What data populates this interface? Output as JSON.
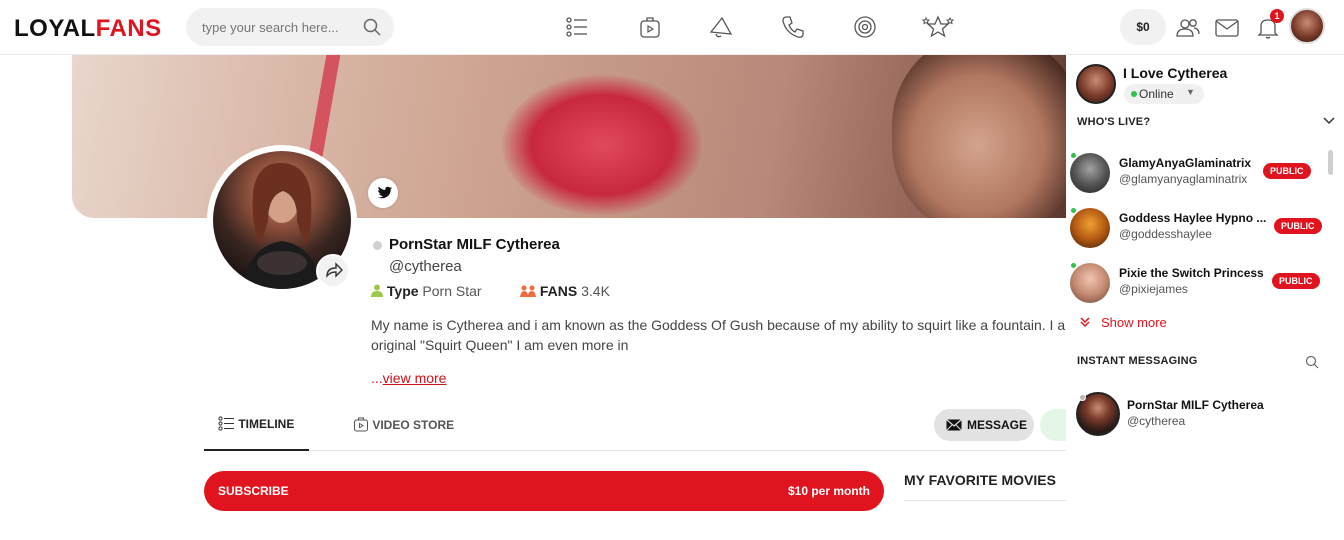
{
  "header": {
    "logo_part1": "LOYAL",
    "logo_part2": "FANS",
    "search_placeholder": "type your search here...",
    "nav_icons": [
      "timeline-list-icon",
      "video-store-icon",
      "megaphone-icon",
      "phone-icon",
      "target-icon",
      "stars-icon"
    ],
    "wallet_balance": "$0",
    "notification_count": "1"
  },
  "profile": {
    "name": "PornStar MILF Cytherea",
    "handle": "@cytherea",
    "type_label": "Type",
    "type_value": "Porn Star",
    "fans_label": "FANS",
    "fans_value": "3.4K",
    "bio_line1": "My name is Cytherea and i am known as the Goddess Of Gush because of my ability to squirt like a fountain. I am",
    "bio_line2": "original \"Squirt Queen\" I am even more in",
    "view_more_prefix": "...",
    "view_more": "view more"
  },
  "tabs": [
    {
      "label": "TIMELINE"
    },
    {
      "label": "VIDEO STORE"
    }
  ],
  "actions": {
    "message_label": "MESSAGE",
    "subscribe_label": "SUBSCRIBE",
    "subscribe_price": "$10 per month",
    "favorites_title": "MY FAVORITE MOVIES"
  },
  "sidebar": {
    "user_name": "I Love Cytherea",
    "status": "Online",
    "whos_live_title": "WHO'S LIVE?",
    "live": [
      {
        "name": "GlamyAnyaGlaminatrix",
        "handle": "@glamyanyaglaminatrix",
        "badge": "PUBLIC"
      },
      {
        "name": "Goddess Haylee Hypno ...",
        "handle": "@goddesshaylee",
        "badge": "PUBLIC"
      },
      {
        "name": "Pixie the Switch Princess",
        "handle": "@pixiejames",
        "badge": "PUBLIC"
      }
    ],
    "show_more": "Show more",
    "im_title": "INSTANT MESSAGING",
    "im_contacts": [
      {
        "name": "PornStar MILF Cytherea",
        "handle": "@cytherea"
      }
    ]
  },
  "colors": {
    "brand_red": "#e0141e",
    "online_green": "#2ec34a"
  }
}
